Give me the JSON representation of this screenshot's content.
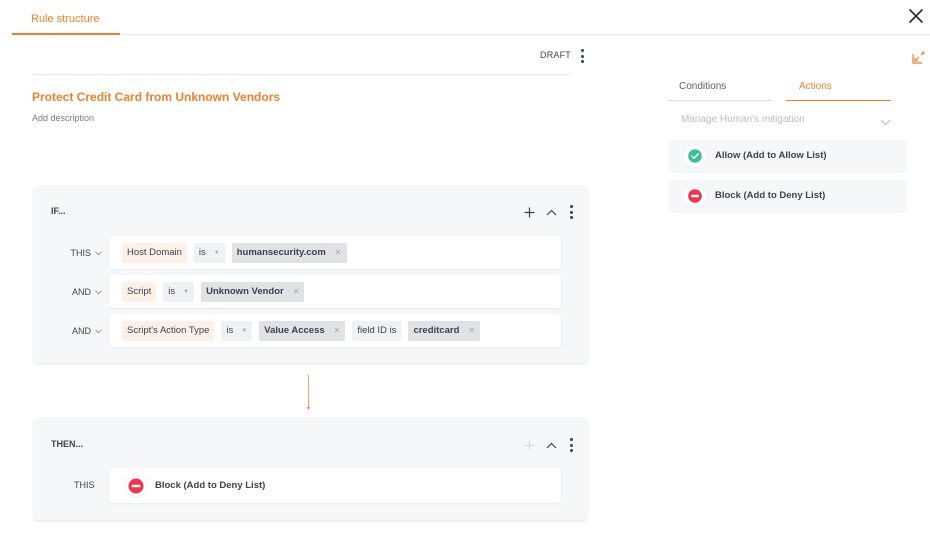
{
  "header": {
    "tab_label": "Rule structure",
    "close_icon": "close-icon",
    "expand_icon": "collapse-expand-icon"
  },
  "rule": {
    "status": "DRAFT",
    "title": "Protect Credit Card from Unknown Vendors",
    "description_placeholder": "Add description"
  },
  "if_block": {
    "label": "IF...",
    "conditions": [
      {
        "operator": "THIS",
        "field": "Host Domain",
        "comparator": "is",
        "values": [
          "humansecurity.com"
        ]
      },
      {
        "operator": "AND",
        "field": "Script",
        "comparator": "is",
        "values": [
          "Unknown Vendor"
        ]
      },
      {
        "operator": "AND",
        "field": "Script's Action Type",
        "comparator": "is",
        "values": [
          "Value Access"
        ],
        "extra_label": "field ID is",
        "extra_values": [
          "creditcard"
        ]
      }
    ]
  },
  "then_block": {
    "label": "THEN...",
    "row_label": "THIS",
    "action": "Block (Add to Deny List)"
  },
  "side_panel": {
    "tabs": [
      {
        "label": "Conditions",
        "active": false
      },
      {
        "label": "Actions",
        "active": true
      }
    ],
    "section_title": "Manage Human's mitigation",
    "actions": [
      {
        "label": "Allow (Add to Allow List)",
        "icon": "check-circle-icon",
        "color": "#3dbf95"
      },
      {
        "label": "Block (Add to Deny List)",
        "icon": "block-circle-icon",
        "color": "#f0344f"
      }
    ]
  },
  "colors": {
    "accent": "#f07f2a",
    "allow": "#3dbf95",
    "block": "#f0344f",
    "field_chip_bg": "#fdf0e6",
    "value_chip_bg": "#e1e2e6",
    "panel_bg": "#f6f7f9"
  }
}
